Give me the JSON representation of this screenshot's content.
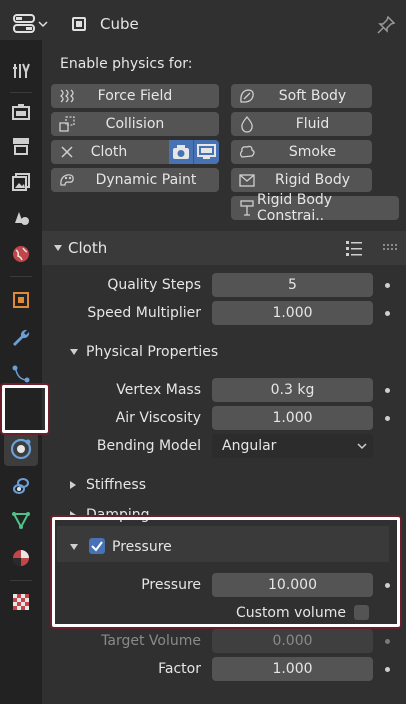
{
  "header": {
    "object_name": "Cube",
    "editor_icon": "properties-editor-icon",
    "pin_icon": "pin-icon"
  },
  "tabs": [
    {
      "name": "tool",
      "icon": "tool-icon"
    },
    {
      "name": "render",
      "icon": "render-icon"
    },
    {
      "name": "output",
      "icon": "output-icon"
    },
    {
      "name": "view-layer",
      "icon": "view-layer-icon"
    },
    {
      "name": "scene",
      "icon": "scene-icon"
    },
    {
      "name": "world",
      "icon": "world-icon"
    },
    {
      "name": "object",
      "icon": "object-icon"
    },
    {
      "name": "modifiers",
      "icon": "wrench-icon"
    },
    {
      "name": "particles",
      "icon": "particles-icon"
    },
    {
      "name": "physics",
      "icon": "physics-icon",
      "active": true
    },
    {
      "name": "constraints",
      "icon": "constraints-icon"
    },
    {
      "name": "data",
      "icon": "mesh-data-icon"
    },
    {
      "name": "material",
      "icon": "material-icon"
    },
    {
      "name": "texture",
      "icon": "texture-icon"
    }
  ],
  "physics": {
    "enable_label": "Enable physics for:",
    "buttons": {
      "force_field": "Force Field",
      "soft_body": "Soft Body",
      "collision": "Collision",
      "fluid": "Fluid",
      "cloth": "Cloth",
      "smoke": "Smoke",
      "dynamic_paint": "Dynamic Paint",
      "rigid_body": "Rigid Body",
      "rigid_body_constraint": "Rigid Body Constrai.."
    }
  },
  "cloth": {
    "title": "Cloth",
    "quality_steps": {
      "label": "Quality Steps",
      "value": "5"
    },
    "speed_multiplier": {
      "label": "Speed Multiplier",
      "value": "1.000"
    },
    "physical_properties": {
      "title": "Physical Properties",
      "vertex_mass": {
        "label": "Vertex Mass",
        "value": "0.3 kg"
      },
      "air_viscosity": {
        "label": "Air Viscosity",
        "value": "1.000"
      },
      "bending_model": {
        "label": "Bending Model",
        "value": "Angular"
      }
    },
    "stiffness": "Stiffness",
    "damping": "Damping",
    "pressure_section": {
      "title": "Pressure",
      "checked": true,
      "pressure": {
        "label": "Pressure",
        "value": "10.000"
      },
      "custom_volume": {
        "label": "Custom volume",
        "checked": false
      },
      "target_volume": {
        "label": "Target Volume",
        "value": "0.000"
      },
      "factor": {
        "label": "Factor",
        "value": "1.000"
      }
    }
  },
  "colors": {
    "highlight_outline": "#ffffff",
    "highlight_shadow": "#6a1f2a",
    "checkbox_accent": "#4772b3"
  }
}
